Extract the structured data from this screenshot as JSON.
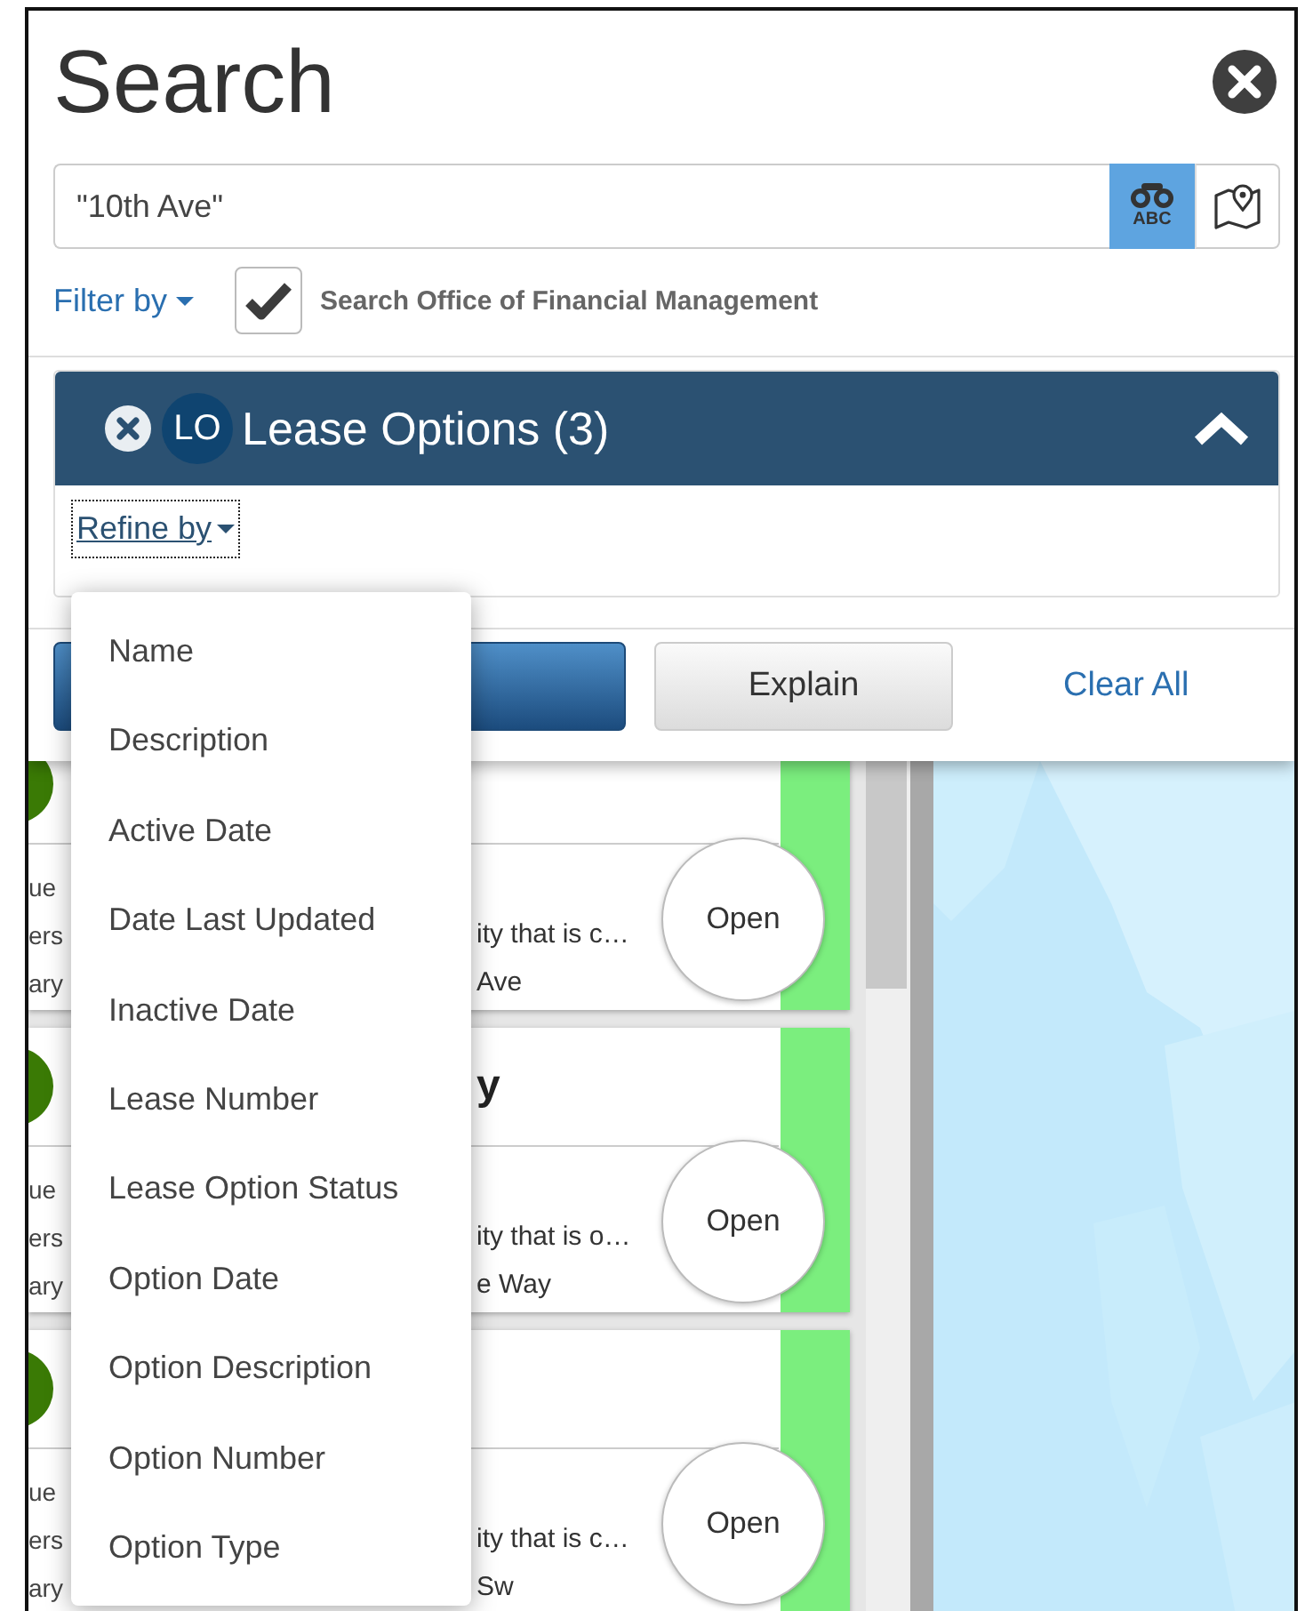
{
  "search_panel": {
    "title": "Search",
    "query": "\"10th Ave\"",
    "mode_label": "ABC",
    "filter_label": "Filter by",
    "scope": {
      "label": "Search Office of Financial Management",
      "checked": true
    },
    "category": {
      "badge": "LO",
      "title": "Lease Options (3)",
      "expanded": true,
      "refine_label": "Refine by"
    },
    "buttons": [
      {
        "kind": "primary"
      },
      {
        "kind": "secondary",
        "label": "Explain"
      },
      {
        "kind": "link",
        "label": "Clear All"
      }
    ]
  },
  "refine_menu": {
    "items": [
      "Name",
      "Description",
      "Active Date",
      "Date Last Updated",
      "Inactive Date",
      "Lease Number",
      "Lease Option Status",
      "Option Date",
      "Option Description",
      "Option Number",
      "Option Type"
    ]
  },
  "results": [
    {
      "left_lines": [
        "ue",
        "ers",
        "ary"
      ],
      "lines": [
        "ity that is c…",
        "Ave"
      ],
      "action": "Open"
    },
    {
      "title": "y",
      "left_lines": [
        "ue",
        "ers",
        "ary"
      ],
      "lines": [
        "ity that is o…",
        "e Way"
      ],
      "action": "Open"
    },
    {
      "left_lines": [
        "ue",
        "ers",
        "ary"
      ],
      "lines": [
        "ity that is c…",
        "Sw"
      ],
      "action": "Open"
    }
  ]
}
